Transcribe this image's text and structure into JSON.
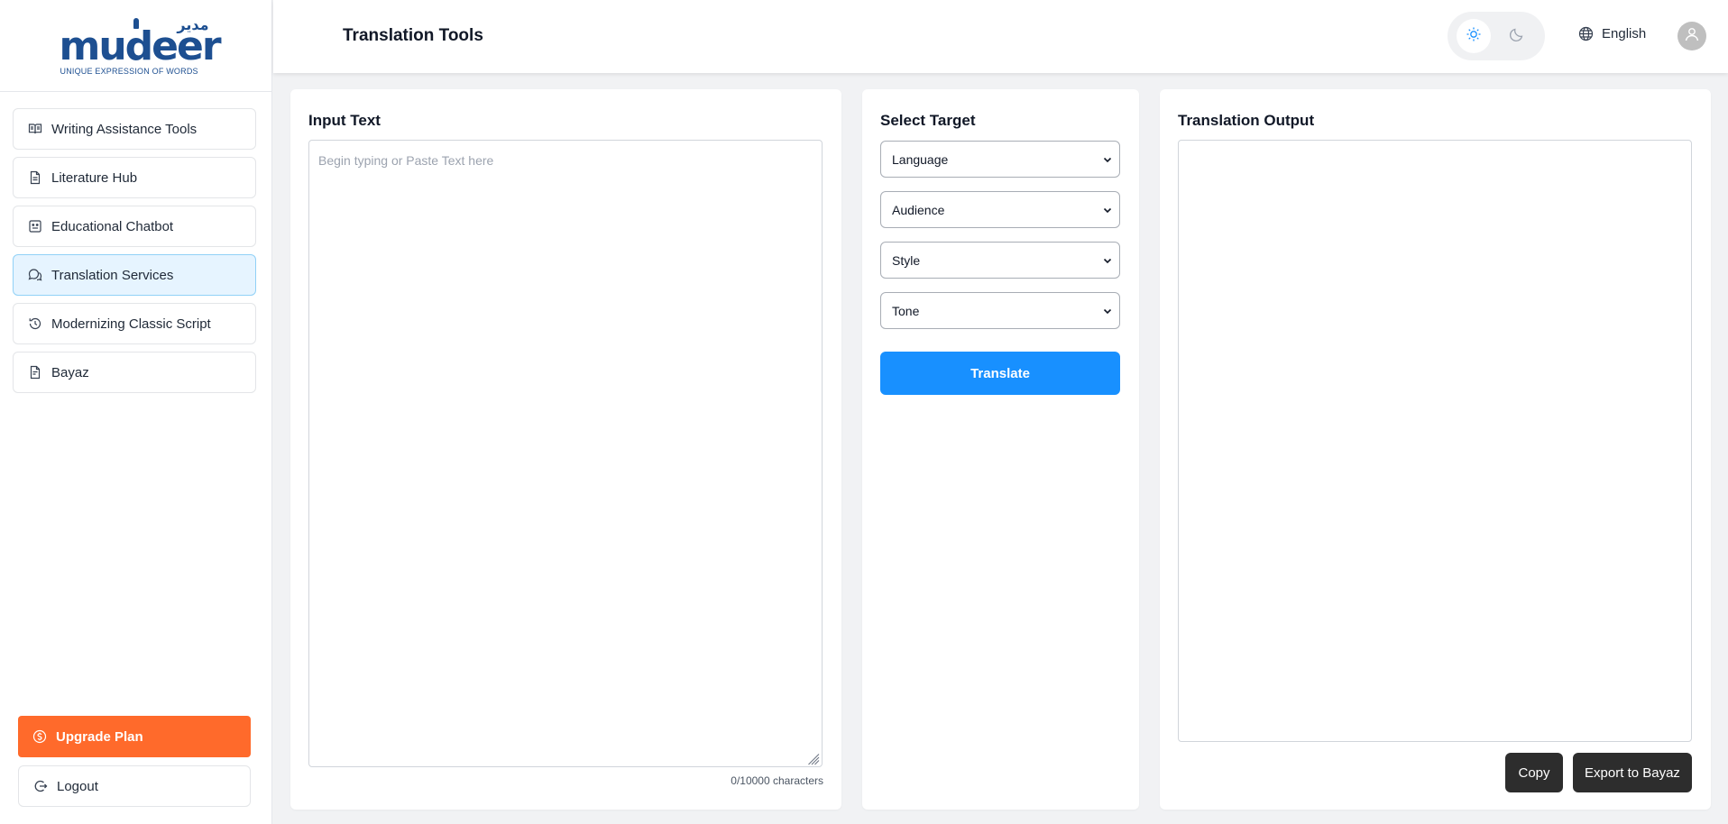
{
  "brand": {
    "name": "mudeer",
    "arabic": "مدير",
    "tagline": "UNIQUE EXPRESSION OF WORDS",
    "color": "#1d4f91"
  },
  "sidebar": {
    "items": [
      {
        "label": "Writing Assistance Tools",
        "icon": "book-open-icon"
      },
      {
        "label": "Literature Hub",
        "icon": "file-text-icon"
      },
      {
        "label": "Educational Chatbot",
        "icon": "robot-icon"
      },
      {
        "label": "Translation Services",
        "icon": "chat-bubbles-icon",
        "active": true
      },
      {
        "label": "Modernizing Classic Script",
        "icon": "history-icon"
      },
      {
        "label": "Bayaz",
        "icon": "file-icon"
      }
    ],
    "upgrade_label": "Upgrade Plan",
    "logout_label": "Logout"
  },
  "header": {
    "title": "Translation Tools",
    "language": "English",
    "theme": "light"
  },
  "input_panel": {
    "title": "Input Text",
    "placeholder": "Begin typing or Paste Text here",
    "value": "",
    "char_count": "0/10000 characters"
  },
  "target_panel": {
    "title": "Select Target",
    "selects": {
      "language": "Language",
      "audience": "Audience",
      "style": "Style",
      "tone": "Tone"
    },
    "translate_label": "Translate"
  },
  "output_panel": {
    "title": "Translation Output",
    "copy_label": "Copy",
    "export_label": "Export to Bayaz"
  },
  "colors": {
    "primary": "#1890ff",
    "upgrade": "#ff6a2b",
    "active_bg": "#e6f4ff",
    "dark_button": "#2d2d2d"
  }
}
